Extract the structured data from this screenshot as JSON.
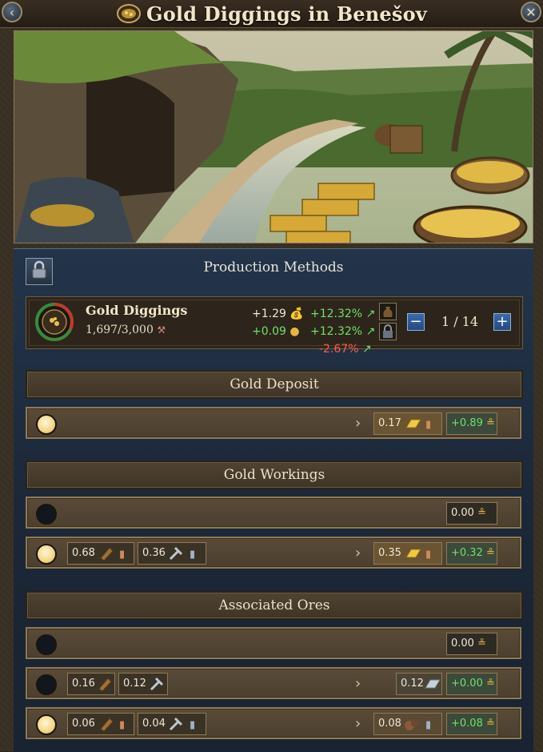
{
  "window": {
    "title": "Gold Diggings in Benešov",
    "back_symbol": "‹",
    "close_symbol": "✕"
  },
  "production_methods": {
    "title": "Production Methods"
  },
  "building": {
    "name": "Gold Diggings",
    "employment": "1,697/3,000",
    "output_value": "+1.29",
    "output_change": "+12.32%",
    "profit_value": "+0.09",
    "profit_change": "+12.32%",
    "third_change": "-2.67%",
    "level": "1 / 14",
    "decrease_label": "−",
    "increase_label": "+"
  },
  "groups": [
    {
      "name": "Gold Deposit",
      "options": [
        {
          "selected": true,
          "inputs": [],
          "output": "0.17",
          "output_icon": "gold-bar-icon",
          "net": "+0.89"
        }
      ]
    },
    {
      "name": "Gold Workings",
      "options": [
        {
          "selected": false,
          "inputs": [],
          "output": "",
          "net": "0.00"
        },
        {
          "selected": true,
          "inputs": [
            {
              "value": "0.68",
              "icon": "wood-icon"
            },
            {
              "value": "0.36",
              "icon": "tools-icon"
            }
          ],
          "output": "0.35",
          "output_icon": "gold-bar-icon",
          "net": "+0.32"
        }
      ]
    },
    {
      "name": "Associated Ores",
      "options": [
        {
          "selected": false,
          "inputs": [],
          "output": "",
          "net": "0.00"
        },
        {
          "selected": false,
          "inputs": [
            {
              "value": "0.16",
              "icon": "wood-icon"
            },
            {
              "value": "0.12",
              "icon": "tools-icon"
            }
          ],
          "output": "0.12",
          "output_icon": "silver-bar-icon",
          "net": "+0.00"
        },
        {
          "selected": true,
          "inputs": [
            {
              "value": "0.06",
              "icon": "wood-icon"
            },
            {
              "value": "0.04",
              "icon": "tools-icon"
            }
          ],
          "output": "0.08",
          "output_icon": "ore-icon",
          "net": "+0.08"
        }
      ]
    }
  ],
  "colors": {
    "positive": "#6ee06a",
    "negative": "#ff5a4a",
    "gold": "#e8b640"
  }
}
